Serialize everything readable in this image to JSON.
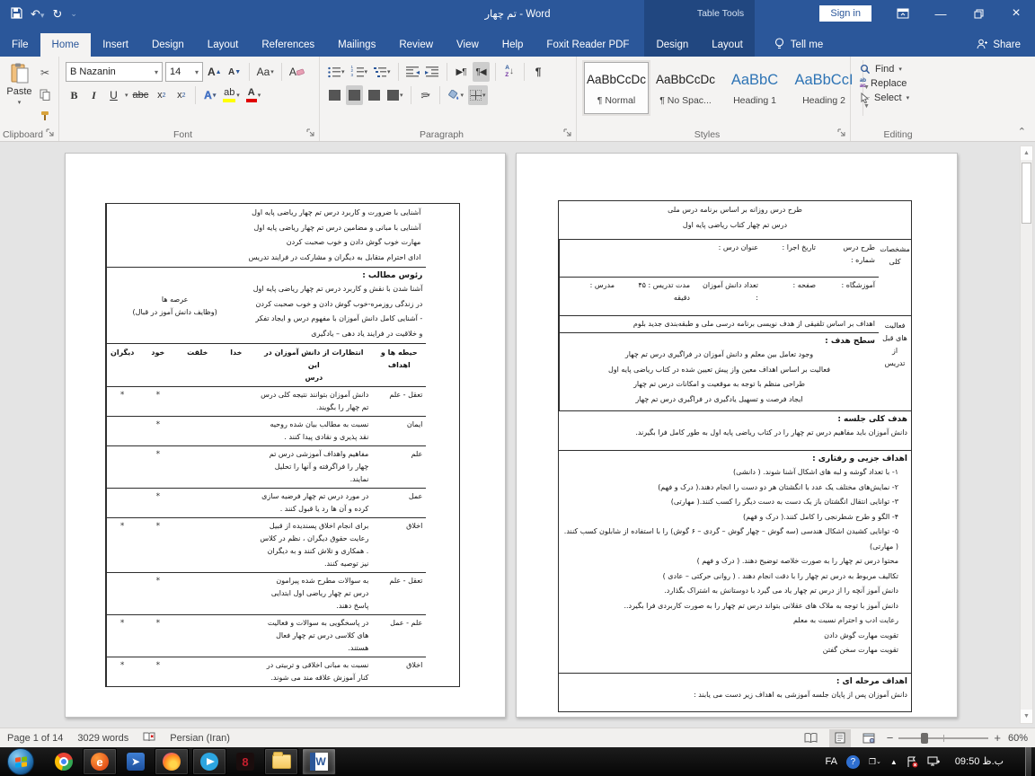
{
  "colors": {
    "accent": "#2b579a",
    "contextual_dark": "#1f4e79",
    "heading_blue": "#2e74b5",
    "highlight_yellow": "#ffff00",
    "font_color_red": "#e00000",
    "taskbar": "#0a0a0a"
  },
  "titlebar": {
    "title": "تم چهار - Word",
    "table_tools": "Table Tools",
    "sign_in": "Sign in"
  },
  "ribbon": {
    "tabs": [
      "File",
      "Home",
      "Insert",
      "Design",
      "Layout",
      "References",
      "Mailings",
      "Review",
      "View",
      "Help",
      "Foxit Reader PDF"
    ],
    "contextual_tabs": [
      "Design",
      "Layout"
    ],
    "tell_me": "Tell me",
    "share": "Share",
    "groups": {
      "clipboard": "Clipboard",
      "font": "Font",
      "paragraph": "Paragraph",
      "styles": "Styles",
      "editing": "Editing"
    },
    "clipboard": {
      "paste": "Paste"
    },
    "font": {
      "name": "B Nazanin",
      "size": "14",
      "change_case": "Aa",
      "bold": "B",
      "italic": "I",
      "underline": "U",
      "strikethrough": "abc"
    },
    "styles": [
      {
        "preview": "AaBbCcDc",
        "name": "¶ Normal"
      },
      {
        "preview": "AaBbCcDc",
        "name": "¶ No Spac..."
      },
      {
        "preview": "AaBbC",
        "name": "Heading 1"
      },
      {
        "preview": "AaBbCcI",
        "name": "Heading 2"
      }
    ],
    "editing": {
      "find": "Find",
      "replace": "Replace",
      "select": "Select"
    }
  },
  "doc": {
    "page1": {
      "title_line1": "طرح درس روزانه بر اساس برنامه درس ملی",
      "title_line2": "درس تم چهار کتاب ریاضی پایه اول",
      "sidebar_specs": "مشخصات\nکلی",
      "specs_row1": [
        "طرح  درس\nشماره :",
        "تاریخ اجرا :",
        "عنوان درس :"
      ],
      "specs_row2": [
        "آموزشگاه :",
        "صفحه :",
        "تعداد دانش آموزان\n:",
        "مدت  تدریس : ۴۵\nدقیقه",
        "مدرس :"
      ],
      "sidebar_pre": "فعالیت\nهای قبل\nاز تدریس",
      "goals_basis": "اهداف بر اساس تلفیقی از هدف نویسی برنامه درسی ملی و طبقه‌بندی جدید بلوم",
      "level_heading": "سطح هدف :",
      "level_lines": "وجود تعامل بین معلم و دانش آموزان در فراگیری درس تم چهار\nفعالیت بر اساس اهداف معین واز پیش تعیین شده در کتاب ریاضی پایه اول\nطراحی منظم با توجه به موقعیت و امکانات درس تم چهار\nایجاد فرصت و تسهیل یادگیری در فراگیری درس تم چهار",
      "overall_heading": "هدف کلی جلسه :",
      "overall_text": "دانش آموزان باید مفاهیم درس تم چهار را در کتاب ریاضی پایه اول به طور کامل فرا بگیرند.",
      "partial_heading": "اهداف جزیی و رفتاری :",
      "partial_lines": "۱- با تعداد گوشه و لبه های اشکال آشنا شوند. ( دانشی)\n۲- نمایش‌های مختلف یک عدد با انگشتان هر دو دست را انجام دهند.( درک و فهم)\n۳- توانایی انتقال انگشتان باز یک دست به دست دیگر را کسب کنند.( مهارتی)\n۴- الگو و طرح شطرنجی را کامل کنند.( درک و فهم)\n۵- توانایی کشیدن اشکال هندسی (سه گوش – چهار گوش – گردی – ۶ گوش) را با استفاده از شابلون کسب کنند.( مهارتی)\nمحتوا درس  تم چهار را به صورت خلاصه توضیح دهند. ( درک و فهم )\nتکالیف مربوط به درس تم چهار را با دقت انجام دهند . ( روانی حرکتی – عادی )\nدانش آموز آنچه را از درس تم چهار یاد می گیرد با دوستانش به اشتراک بگذارد.\nدانش آموز  با توجه به ملاک های عقلانی بتواند درس تم چهار را به صورت کاربردی فرا بگیرد..\nرعایت ادب و احترام نسبت به معلم\nتقویت مهارت گوش دادن\nتقویت مهارت سخن گفتن",
      "stage_heading": "اهداف مرحله ای :",
      "stage_text": "دانش آموزان پس از پایان جلسه آموزشی به اهداف زیر دست می یابند :"
    },
    "page2": {
      "intro_lines": "آشنایی با ضرورت و کاربرد درس  تم چهار ریاضی پایه اول\nآشنایی با مبانی و مضامین درس تم چهار ریاضی پایه اول\nمهارت خوب گوش دادن و خوب صحبت کردن\nادای احترام متقابل به دیگران و مشارکت در فرایند تدریس",
      "topics_heading": "رئوس مطالب :",
      "topics_lines": "آشنا شدن با نقش و کاربرد درس تم چهار ریاضی پایه اول\nدر زندگی روزمره-خوب گوش دادن و خوب صحبت کردن\n- آشنایی کامل دانش آموزان با مفهوم درس و ایجاد تفکر\nو خلاقیت در فرایند یاد دهی – یادگیری",
      "domains_label": "عرصه ها\n(وظایف دانش آموز در قبال)",
      "header": {
        "domain": "حیطه ها و\nاهداف",
        "expect": "انتظارات از دانش آموزان در این\nدرس",
        "khoda": "خدا",
        "khelqat": "خلقت",
        "khod": "خود",
        "digaran": "دیگران"
      },
      "rows": [
        {
          "domain": "تعقل - علم",
          "text": "دانش آموزان بتوانند نتیجه کلی  درس تم چهار را بگویند.",
          "khoda": "",
          "khelqat": "",
          "khod": "*",
          "digaran": "*"
        },
        {
          "domain": "ایمان",
          "text": "نسبت به مطالب بیان شده روحیه نقد پذیری و نقادی پیدا کنند .",
          "khoda": "",
          "khelqat": "",
          "khod": "*",
          "digaran": ""
        },
        {
          "domain": "علم",
          "text": "مفاهیم واهداف آموزشی  درس تم چهار را فراگرفته و آنها را تحلیل نمایند.",
          "khoda": "",
          "khelqat": "",
          "khod": "*",
          "digaran": ""
        },
        {
          "domain": "عمل",
          "text": "در مورد   درس تم چهار فرضیه سازی کرده و آن ها رد یا قبول کنند .",
          "khoda": "",
          "khelqat": "",
          "khod": "*",
          "digaran": ""
        },
        {
          "domain": "اخلاق",
          "text": "برای انجام اخلاق پسندیده از قبیل رعایت حقوق دیگران ، نظم در کلاس . همکاری و تلاش کنند و به دیگران نیز توصیه کنند.",
          "khoda": "",
          "khelqat": "",
          "khod": "*",
          "digaran": "*"
        },
        {
          "domain": "تعقل - علم",
          "text": "به سوالات مطرح شده پیرامون درس تم چهار ریاضی اول ابتدایی پاسخ دهند.",
          "khoda": "",
          "khelqat": "",
          "khod": "*",
          "digaran": ""
        },
        {
          "domain": "علم - عمل",
          "text": "در پاسخگویی به سوالات و فعالیت های کلاسی   درس تم چهار فعال هستند.",
          "khoda": "",
          "khelqat": "",
          "khod": "*",
          "digaran": "*"
        },
        {
          "domain": "اخلاق",
          "text": "نسبت به مبانی اخلاقی و تربیتی در کنار آموزش علاقه مند می شوند.",
          "khoda": "",
          "khelqat": "",
          "khod": "*",
          "digaran": "*"
        }
      ]
    }
  },
  "status": {
    "page": "Page 1 of 14",
    "words": "3029 words",
    "language": "Persian (Iran)",
    "zoom": "60%"
  },
  "taskbar": {
    "language": "FA",
    "meridiem": "ب.ظ",
    "time": "09:50"
  }
}
